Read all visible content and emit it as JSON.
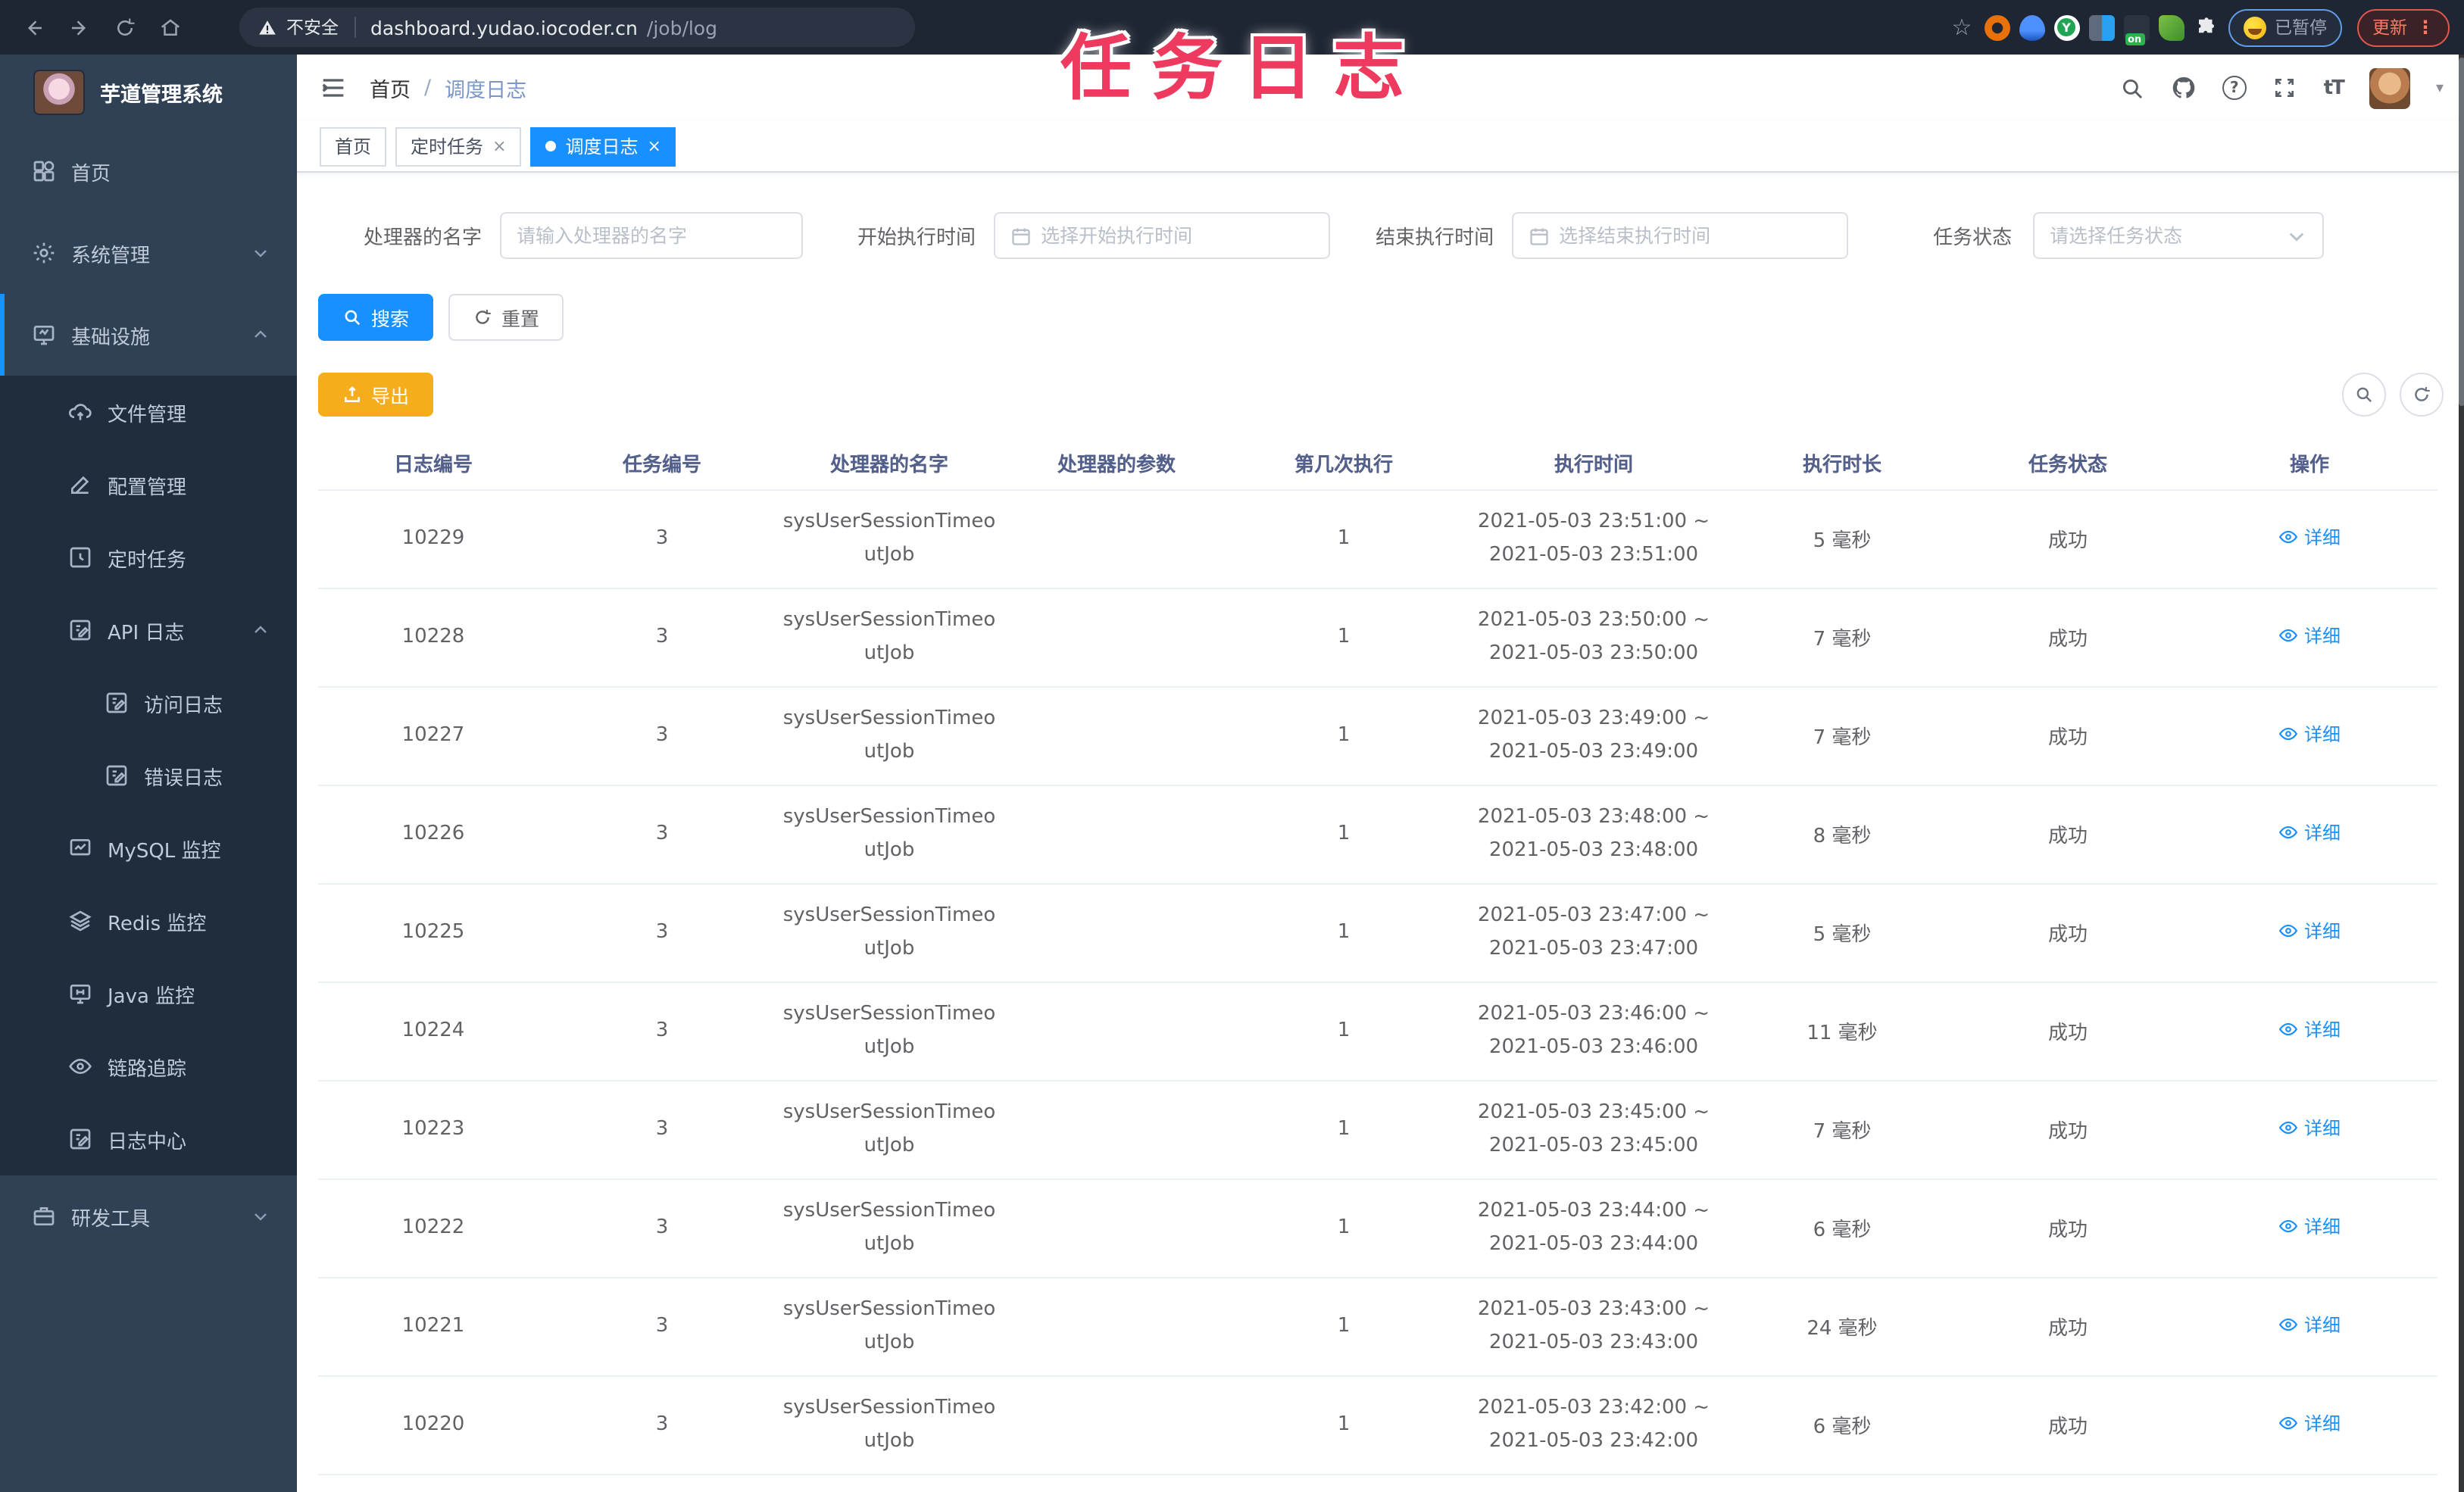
{
  "browser": {
    "security_label": "不安全",
    "url_host": "dashboard.yudao.iocoder.cn",
    "url_path": "/job/log",
    "paused_badge": "已暂停",
    "update_button": "更新"
  },
  "icons": {
    "star": "☆",
    "close": "×",
    "separator": "/",
    "caret": "▾",
    "kebab": "⋮",
    "help": "?",
    "text_size": "tT",
    "on_badge": "on",
    "y_badge": "Y",
    "puzzle": "⬡"
  },
  "overlay": {
    "title": "任务日志"
  },
  "sidebar": {
    "app_title": "芋道管理系统",
    "items": [
      {
        "label": "首页",
        "icon": "dashboard-icon"
      },
      {
        "label": "系统管理",
        "icon": "gear-icon"
      },
      {
        "label": "基础设施",
        "icon": "infrastructure-icon"
      },
      {
        "label": "文件管理",
        "icon": "cloud-upload-icon"
      },
      {
        "label": "配置管理",
        "icon": "edit-icon"
      },
      {
        "label": "定时任务",
        "icon": "timer-icon"
      },
      {
        "label": "API 日志",
        "icon": "log-icon"
      },
      {
        "label": "访问日志",
        "icon": "log-icon"
      },
      {
        "label": "错误日志",
        "icon": "log-icon"
      },
      {
        "label": "MySQL 监控",
        "icon": "mysql-monitor-icon"
      },
      {
        "label": "Redis 监控",
        "icon": "layers-icon"
      },
      {
        "label": "Java 监控",
        "icon": "java-monitor-icon"
      },
      {
        "label": "链路追踪",
        "icon": "eye-icon"
      },
      {
        "label": "日志中心",
        "icon": "log-icon"
      },
      {
        "label": "研发工具",
        "icon": "toolbox-icon"
      }
    ]
  },
  "header": {
    "breadcrumb_home": "首页",
    "breadcrumb_current": "调度日志"
  },
  "tabs": [
    {
      "label": "首页"
    },
    {
      "label": "定时任务"
    },
    {
      "label": "调度日志"
    }
  ],
  "filters": {
    "handler_label": "处理器的名字",
    "handler_placeholder": "请输入处理器的名字",
    "start_label": "开始执行时间",
    "start_placeholder": "选择开始执行时间",
    "end_label": "结束执行时间",
    "end_placeholder": "选择结束执行时间",
    "status_label": "任务状态",
    "status_placeholder": "请选择任务状态",
    "search_button": "搜索",
    "reset_button": "重置",
    "export_button": "导出"
  },
  "table": {
    "columns": [
      "日志编号",
      "任务编号",
      "处理器的名字",
      "处理器的参数",
      "第几次执行",
      "执行时间",
      "执行时长",
      "任务状态",
      "操作"
    ],
    "action_label": "详细",
    "rows": [
      {
        "log_id": "10229",
        "job_id": "3",
        "handler": "sysUserSessionTimeoutJob",
        "param": "",
        "count": "1",
        "time_start": "2021-05-03 23:51:00 ~",
        "time_end": "2021-05-03 23:51:00",
        "duration": "5 毫秒",
        "status": "成功"
      },
      {
        "log_id": "10228",
        "job_id": "3",
        "handler": "sysUserSessionTimeoutJob",
        "param": "",
        "count": "1",
        "time_start": "2021-05-03 23:50:00 ~",
        "time_end": "2021-05-03 23:50:00",
        "duration": "7 毫秒",
        "status": "成功"
      },
      {
        "log_id": "10227",
        "job_id": "3",
        "handler": "sysUserSessionTimeoutJob",
        "param": "",
        "count": "1",
        "time_start": "2021-05-03 23:49:00 ~",
        "time_end": "2021-05-03 23:49:00",
        "duration": "7 毫秒",
        "status": "成功"
      },
      {
        "log_id": "10226",
        "job_id": "3",
        "handler": "sysUserSessionTimeoutJob",
        "param": "",
        "count": "1",
        "time_start": "2021-05-03 23:48:00 ~",
        "time_end": "2021-05-03 23:48:00",
        "duration": "8 毫秒",
        "status": "成功"
      },
      {
        "log_id": "10225",
        "job_id": "3",
        "handler": "sysUserSessionTimeoutJob",
        "param": "",
        "count": "1",
        "time_start": "2021-05-03 23:47:00 ~",
        "time_end": "2021-05-03 23:47:00",
        "duration": "5 毫秒",
        "status": "成功"
      },
      {
        "log_id": "10224",
        "job_id": "3",
        "handler": "sysUserSessionTimeoutJob",
        "param": "",
        "count": "1",
        "time_start": "2021-05-03 23:46:00 ~",
        "time_end": "2021-05-03 23:46:00",
        "duration": "11 毫秒",
        "status": "成功"
      },
      {
        "log_id": "10223",
        "job_id": "3",
        "handler": "sysUserSessionTimeoutJob",
        "param": "",
        "count": "1",
        "time_start": "2021-05-03 23:45:00 ~",
        "time_end": "2021-05-03 23:45:00",
        "duration": "7 毫秒",
        "status": "成功"
      },
      {
        "log_id": "10222",
        "job_id": "3",
        "handler": "sysUserSessionTimeoutJob",
        "param": "",
        "count": "1",
        "time_start": "2021-05-03 23:44:00 ~",
        "time_end": "2021-05-03 23:44:00",
        "duration": "6 毫秒",
        "status": "成功"
      },
      {
        "log_id": "10221",
        "job_id": "3",
        "handler": "sysUserSessionTimeoutJob",
        "param": "",
        "count": "1",
        "time_start": "2021-05-03 23:43:00 ~",
        "time_end": "2021-05-03 23:43:00",
        "duration": "24 毫秒",
        "status": "成功"
      },
      {
        "log_id": "10220",
        "job_id": "3",
        "handler": "sysUserSessionTimeoutJob",
        "param": "",
        "count": "1",
        "time_start": "2021-05-03 23:42:00 ~",
        "time_end": "2021-05-03 23:42:00",
        "duration": "6 毫秒",
        "status": "成功"
      }
    ]
  },
  "colors": {
    "accent": "#1890ff",
    "warning": "#f5ad1c",
    "sidebar_bg": "#304156",
    "submenu_bg": "#1f2d3d",
    "annotation_pink": "#ee3a5f"
  }
}
